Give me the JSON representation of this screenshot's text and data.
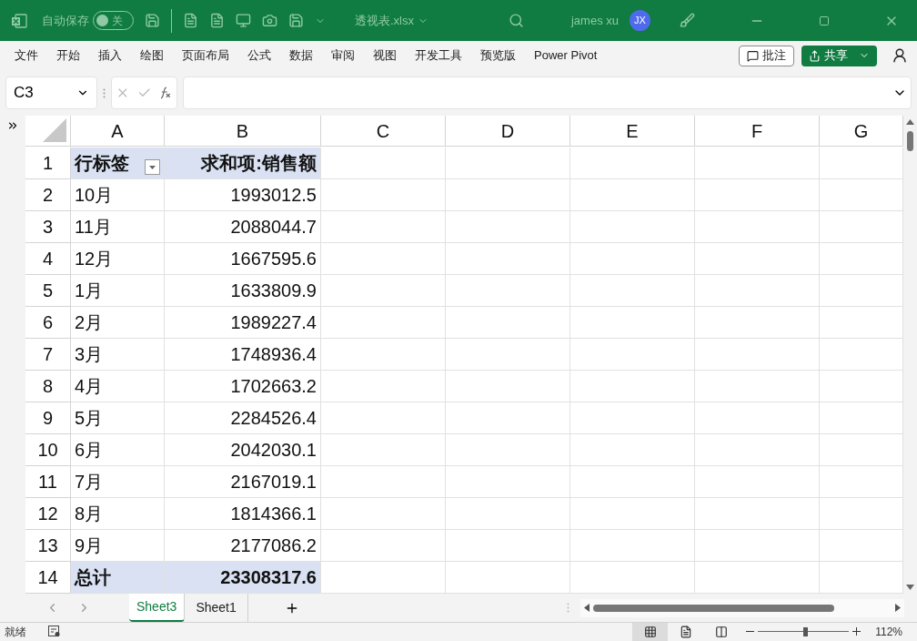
{
  "title_bar": {
    "autosave_label": "自动保存",
    "autosave": {
      "on": false,
      "label": "关"
    },
    "filename": "透视表.xlsx",
    "user": "james xu",
    "avatar": "JX"
  },
  "ribbon_tabs": [
    "文件",
    "开始",
    "插入",
    "绘图",
    "页面布局",
    "公式",
    "数据",
    "审阅",
    "视图",
    "开发工具",
    "预览版",
    "Power Pivot"
  ],
  "ribbon_buttons": {
    "comments": "批注",
    "share": "共享"
  },
  "formula_bar": {
    "name_box": "C3"
  },
  "sheet": {
    "columns": [
      "A",
      "B",
      "C",
      "D",
      "E",
      "F",
      "G"
    ],
    "rows": [
      {
        "number": "1",
        "kind": "header",
        "cells": [
          "行标签",
          "求和项:销售额"
        ]
      },
      {
        "number": "2",
        "kind": "data",
        "cells": [
          "10月",
          "1993012.5"
        ]
      },
      {
        "number": "3",
        "kind": "data",
        "cells": [
          "11月",
          "2088044.7"
        ]
      },
      {
        "number": "4",
        "kind": "data",
        "cells": [
          "12月",
          "1667595.6"
        ]
      },
      {
        "number": "5",
        "kind": "data",
        "cells": [
          "1月",
          "1633809.9"
        ]
      },
      {
        "number": "6",
        "kind": "data",
        "cells": [
          "2月",
          "1989227.4"
        ]
      },
      {
        "number": "7",
        "kind": "data",
        "cells": [
          "3月",
          "1748936.4"
        ]
      },
      {
        "number": "8",
        "kind": "data",
        "cells": [
          "4月",
          "1702663.2"
        ]
      },
      {
        "number": "9",
        "kind": "data",
        "cells": [
          "5月",
          "2284526.4"
        ]
      },
      {
        "number": "10",
        "kind": "data",
        "cells": [
          "6月",
          "2042030.1"
        ]
      },
      {
        "number": "11",
        "kind": "data",
        "cells": [
          "7月",
          "2167019.1"
        ]
      },
      {
        "number": "12",
        "kind": "data",
        "cells": [
          "8月",
          "1814366.1"
        ]
      },
      {
        "number": "13",
        "kind": "data",
        "cells": [
          "9月",
          "2177086.2"
        ]
      },
      {
        "number": "14",
        "kind": "total",
        "cells": [
          "总计",
          "23308317.6"
        ]
      }
    ]
  },
  "sheet_tabs": [
    {
      "label": "Sheet3",
      "selected": true
    },
    {
      "label": "Sheet1",
      "selected": false
    }
  ],
  "status_bar": {
    "status": "就绪",
    "views": [
      {
        "kind": "normal",
        "selected": true
      },
      {
        "kind": "page_layout",
        "selected": false
      },
      {
        "kind": "page_break",
        "selected": false
      }
    ],
    "zoom": {
      "level": 0.52,
      "reading": "112%"
    }
  }
}
